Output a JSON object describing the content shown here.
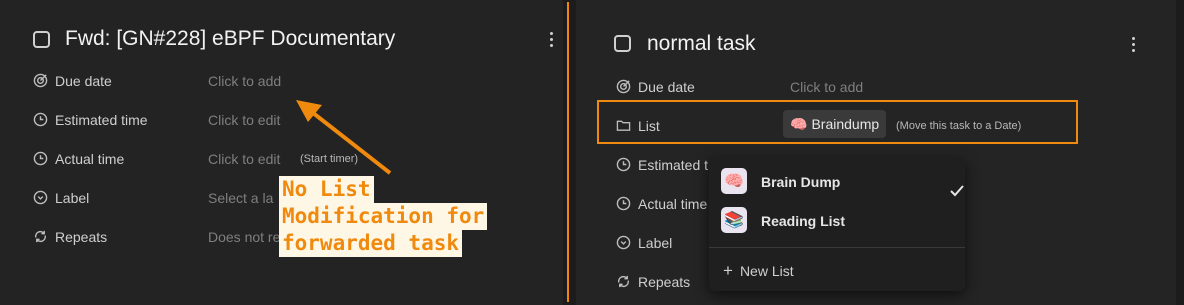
{
  "left_task": {
    "title": "Fwd: [GN#228] eBPF Documentary",
    "fields": {
      "due_date": {
        "label": "Due date",
        "value": "Click to add"
      },
      "estimated_time": {
        "label": "Estimated time",
        "value": "Click to edit"
      },
      "actual_time": {
        "label": "Actual time",
        "value": "Click to edit",
        "extra": "(Start timer)"
      },
      "label": {
        "label": "Label",
        "value": "Select a la"
      },
      "repeats": {
        "label": "Repeats",
        "value": "Does not re"
      }
    }
  },
  "annotation": {
    "lines": [
      "No List",
      "Modification for",
      "forwarded task"
    ]
  },
  "right_task": {
    "title": "normal task",
    "fields": {
      "due_date": {
        "label": "Due date",
        "value": "Click to add"
      },
      "list": {
        "label": "List",
        "chip_label": "Braindump",
        "chip_emoji": "🧠",
        "move_hint": "(Move this task to a Date)"
      },
      "estimated_time": {
        "label": "Estimated t"
      },
      "actual_time": {
        "label": "Actual time"
      },
      "label": {
        "label": "Label"
      },
      "repeats": {
        "label": "Repeats"
      }
    }
  },
  "list_dropdown": {
    "items": [
      {
        "name": "Brain Dump",
        "emoji": "🧠",
        "selected": true
      },
      {
        "name": "Reading List",
        "emoji": "📚",
        "selected": false
      }
    ],
    "new_list_label": "New List"
  },
  "colors": {
    "accent": "#f08a0e",
    "background": "#232323"
  }
}
